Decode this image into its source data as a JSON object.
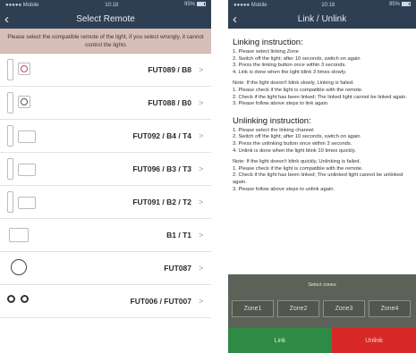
{
  "left": {
    "status": {
      "carrier": "●●●●● Mobile",
      "time": "10:18",
      "battery": "95%"
    },
    "nav": {
      "title": "Select Remote",
      "back": "‹"
    },
    "notice": "Please select the compatible remote of the light, if you select wrongly, it cannot control the lights",
    "items": [
      {
        "label": "FUT089 / B8",
        "icon": "remote-fut089-icon"
      },
      {
        "label": "FUT088 / B0",
        "icon": "remote-fut088-icon"
      },
      {
        "label": "FUT092 / B4 / T4",
        "icon": "remote-fut092-icon"
      },
      {
        "label": "FUT096 / B3 / T3",
        "icon": "remote-fut096-icon"
      },
      {
        "label": "FUT091 / B2 / T2",
        "icon": "remote-fut091-icon"
      },
      {
        "label": "B1 / T1",
        "icon": "remote-b1-icon"
      },
      {
        "label": "FUT087",
        "icon": "remote-fut087-icon"
      },
      {
        "label": "FUT006 / FUT007",
        "icon": "remote-fut006-icon"
      }
    ],
    "chevron": ">"
  },
  "right": {
    "status": {
      "carrier": "●●●●● Mobile",
      "time": "10:18",
      "battery": "95%"
    },
    "nav": {
      "title": "Link / Unlink",
      "back": "‹"
    },
    "link_heading": "Linking instruction:",
    "link_steps": "1. Please select linking Zone\n2. Switch off the light; after 10 seconds, switch on again\n3. Press the linking button once within 3 seconds.\n4. Link is done when the light blink 3 times slowly.",
    "link_note": "Note: If the light doesn't blink slowly, Linking is failed.\n1. Please check if the light is compatible with the remote.\n2. Check if the light has been linked; The linked light cannot be linked again.\n3. Please follow above steps to link again.",
    "unlink_heading": "Unlinking instruction:",
    "unlink_steps": "1. Please select the linking channel\n2. Switch off the light; after 10 seconds, switch on again\n3. Press the unlinking button once within 3 seconds.\n4. Unlink is done when the light blink 10 times quickly.",
    "unlink_note": "Note:  If the light doesn't blink quickly, Unlinking is failed.\n1. Please check if the light is compatible with the remote.\n2. Check if the light has been linked; The unlinked light cannot be unlinked again.\n3. Please follow above steps to unlink again.",
    "zones_title": "Select zones",
    "zones": [
      "Zone1",
      "Zone2",
      "Zone3",
      "Zone4"
    ],
    "link_button": "Link",
    "unlink_button": "Unlink"
  },
  "colors": {
    "nav": "#2e3f54",
    "notice": "#d6bfb9",
    "link": "#2f8a45",
    "unlink": "#d82828",
    "zones": "#5d6258"
  }
}
